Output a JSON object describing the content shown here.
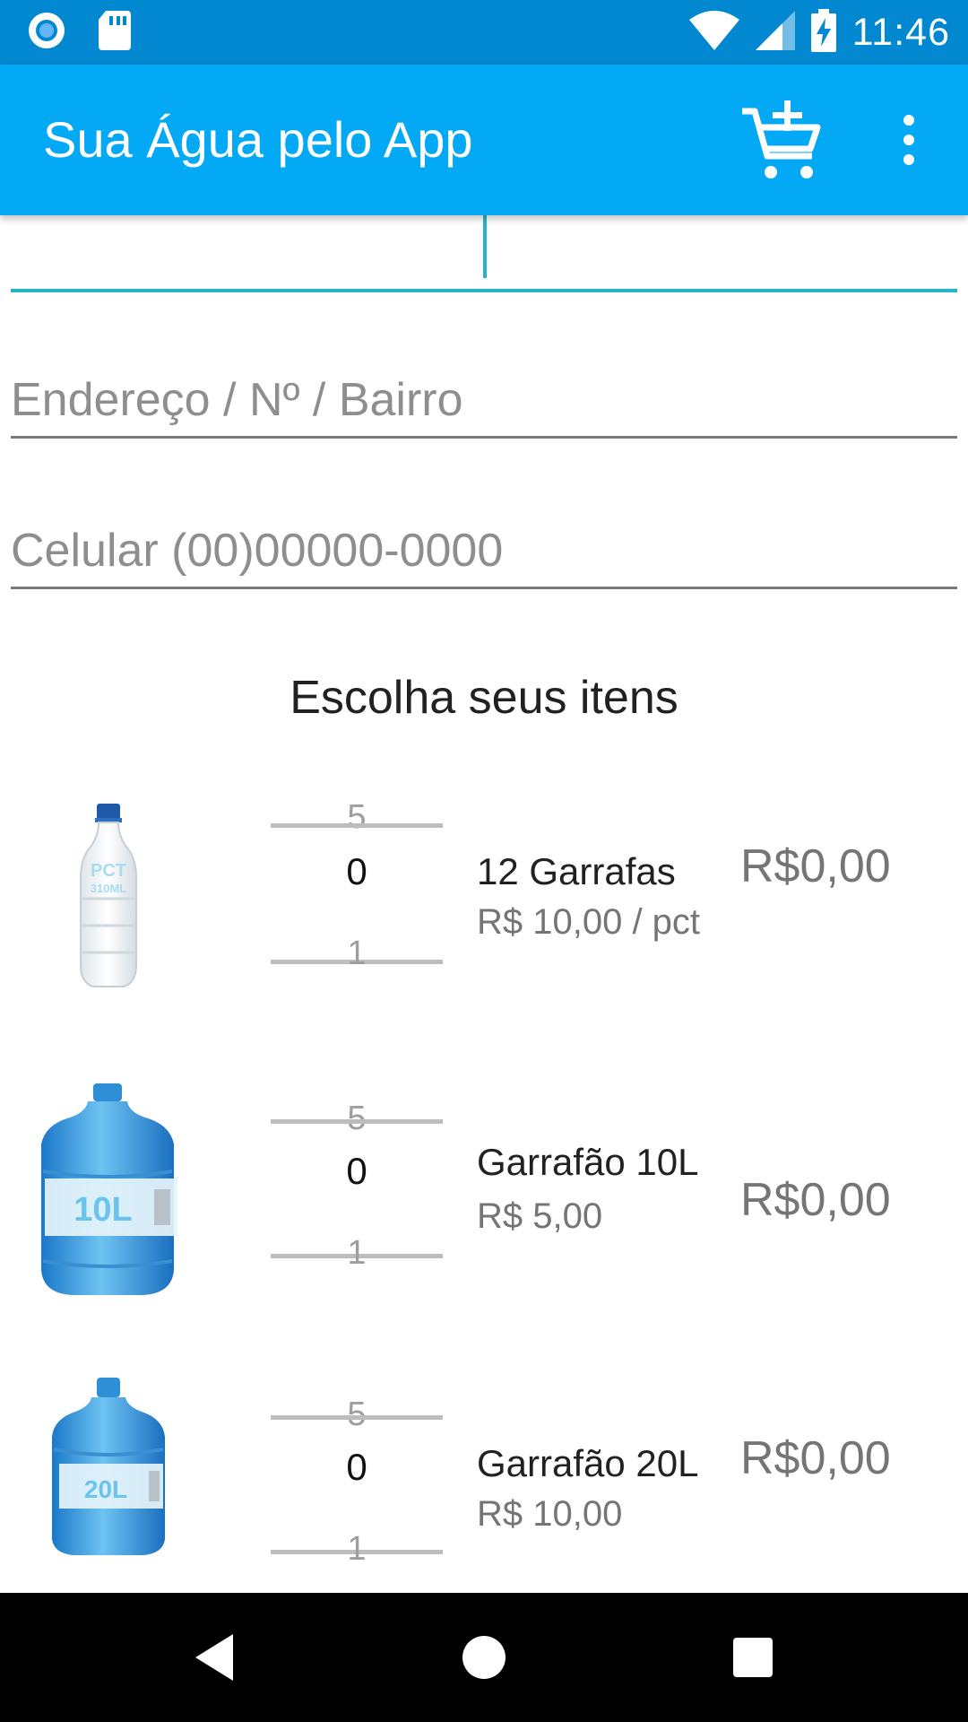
{
  "status_bar": {
    "time": "11:46",
    "left_icons": [
      "radio-icon",
      "sd-card-icon"
    ],
    "right_icons": [
      "wifi-icon",
      "signal-icon",
      "battery-charging-icon"
    ]
  },
  "app_bar": {
    "title": "Sua Água pelo App",
    "cart_icon": "add-to-cart-icon",
    "menu_icon": "more-vert-icon",
    "color": "#03a9f4"
  },
  "form": {
    "name": {
      "value": ""
    },
    "address": {
      "placeholder": "Endereço / Nº / Bairro",
      "value": ""
    },
    "phone": {
      "placeholder": "Celular (00)00000-0000",
      "value": ""
    }
  },
  "section_title": "Escolha seus itens",
  "products": [
    {
      "label_text": "PCT",
      "label_sub": "310ML",
      "picker": {
        "prev": "5",
        "current": "0",
        "next": "1"
      },
      "name": "12 Garrafas",
      "price": "R$ 10,00 / pct",
      "total": "R$0,00"
    },
    {
      "label_text": "10L",
      "picker": {
        "prev": "5",
        "current": "0",
        "next": "1"
      },
      "name": "Garrafão 10L",
      "price": "R$ 5,00",
      "total": "R$0,00"
    },
    {
      "label_text": "20L",
      "picker": {
        "prev": "5",
        "current": "0",
        "next": "1"
      },
      "name": "Garrafão 20L",
      "price": "R$ 10,00",
      "total": "R$0,00"
    }
  ],
  "nav_bar": {
    "buttons": [
      "back-icon",
      "home-icon",
      "recents-icon"
    ]
  }
}
